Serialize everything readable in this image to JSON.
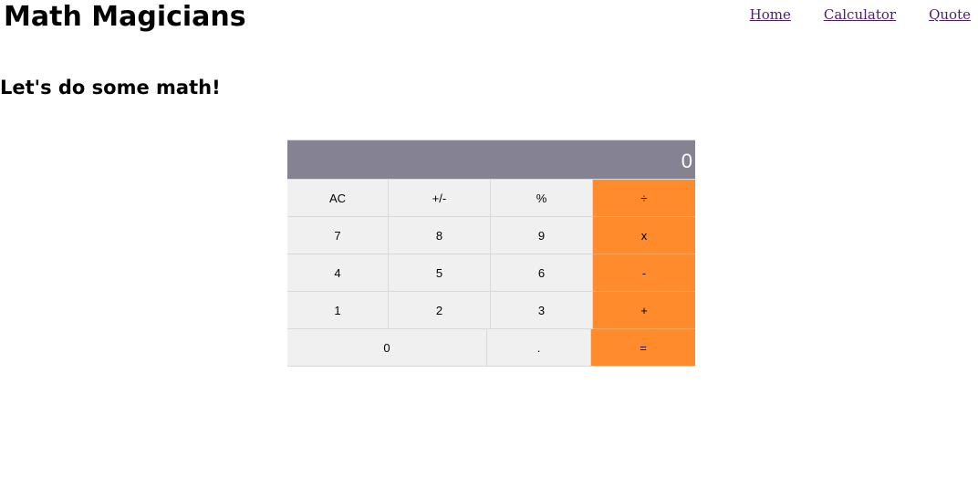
{
  "header": {
    "title": "Math Magicians",
    "nav": [
      {
        "label": "Home"
      },
      {
        "label": "Calculator"
      },
      {
        "label": "Quote"
      }
    ]
  },
  "main": {
    "heading": "Let's do some math!"
  },
  "calculator": {
    "display": "0",
    "rows": [
      [
        "AC",
        "+/-",
        "%",
        "÷"
      ],
      [
        "7",
        "8",
        "9",
        "x"
      ],
      [
        "4",
        "5",
        "6",
        "-"
      ],
      [
        "1",
        "2",
        "3",
        "+"
      ],
      [
        "0",
        ".",
        "="
      ]
    ]
  },
  "colors": {
    "display_bg": "#858393",
    "operator_bg": "#ff8b2c",
    "key_bg": "#f0f0f0",
    "nav_link": "#4b1f6e"
  }
}
